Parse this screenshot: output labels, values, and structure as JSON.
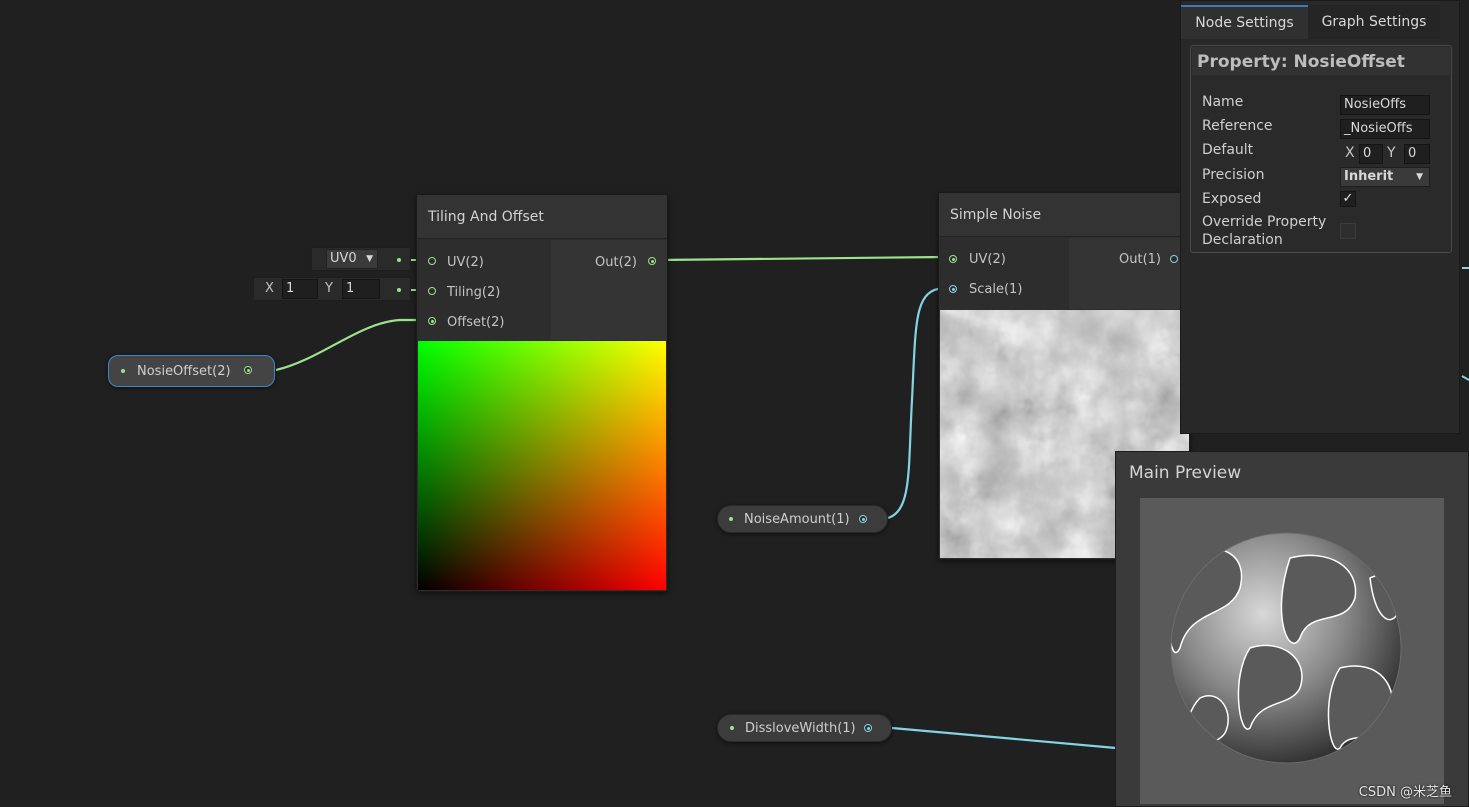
{
  "tiling_node": {
    "title": "Tiling And Offset",
    "inputs": [
      "UV(2)",
      "Tiling(2)",
      "Offset(2)"
    ],
    "output": "Out(2)",
    "uv_dropdown": "UV0",
    "tiling_x_label": "X",
    "tiling_x": "1",
    "tiling_y_label": "Y",
    "tiling_y": "1"
  },
  "noise_node": {
    "title": "Simple Noise",
    "inputs": [
      "UV(2)",
      "Scale(1)"
    ],
    "output": "Out(1)"
  },
  "properties": {
    "nosie_offset": "NosieOffset(2)",
    "noise_amount": "NoiseAmount(1)",
    "dissolve_width": "DissloveWidth(1)"
  },
  "inspector": {
    "tabs": [
      "Node Settings",
      "Graph Settings"
    ],
    "header": "Property: NosieOffset",
    "name_label": "Name",
    "name_value": "NosieOffs",
    "reference_label": "Reference",
    "reference_value": "_NosieOffs",
    "default_label": "Default",
    "default_x_label": "X",
    "default_x": "0",
    "default_y_label": "Y",
    "default_y": "0",
    "precision_label": "Precision",
    "precision_value": "Inherit",
    "exposed_label": "Exposed",
    "exposed_checked": true,
    "override_label_1": "Override Property",
    "override_label_2": "Declaration",
    "override_checked": false
  },
  "main_preview": {
    "title": "Main Preview"
  },
  "watermark": "CSDN @米芝鱼",
  "colors": {
    "vector2_edge": "#9be38c",
    "float_edge": "#84d4e2",
    "selection": "#3a8ac9"
  }
}
